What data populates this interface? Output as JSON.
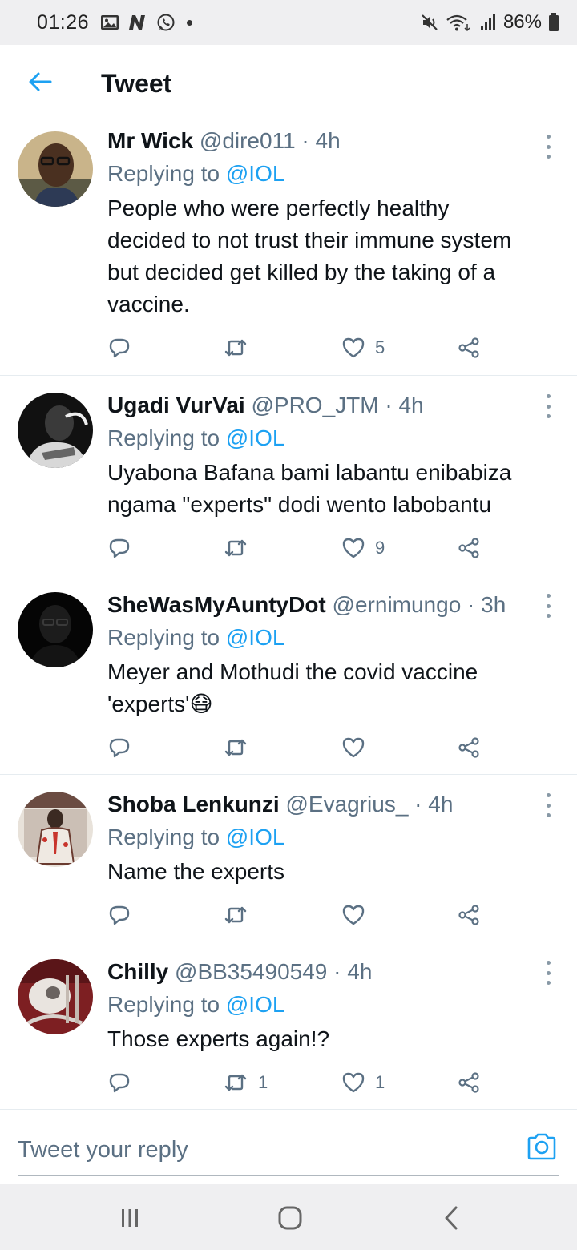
{
  "status_bar": {
    "time": "01:26",
    "battery": "86%",
    "left_icons": [
      "gallery-icon",
      "n-icon",
      "whatsapp-icon",
      "dot"
    ],
    "right_icons": [
      "mute-icon",
      "wifi-icon",
      "signal-icon",
      "battery-icon"
    ]
  },
  "header": {
    "title": "Tweet",
    "back_icon": "arrow-left-icon"
  },
  "colors": {
    "accent": "#1da1f2",
    "muted": "#5b7083",
    "text": "#0f1419",
    "divider": "#e6ecf0"
  },
  "tweets": [
    {
      "name": "Mr Wick",
      "meta": "@dire011 · 4h",
      "replying_prefix": "Replying to ",
      "replying_to": "@IOL",
      "text": "People who were perfectly healthy decided to not trust their immune system but decided get killed by the taking of a vaccine.",
      "replies": "",
      "retweets": "",
      "likes": "5"
    },
    {
      "name": "Ugadi VurVai",
      "meta": "@PRO_JTM · 4h",
      "replying_prefix": "Replying to ",
      "replying_to": "@IOL",
      "text": "Uyabona Bafana bami labantu enibabiza ngama \"experts\" dodi wento labobantu",
      "replies": "",
      "retweets": "",
      "likes": "9"
    },
    {
      "name": "SheWasMyAuntyDot",
      "meta": "@ernimungo · 3h",
      "replying_prefix": "Replying to ",
      "replying_to": "@IOL",
      "text": "Meyer and Mothudi the covid vaccine 'experts'😷",
      "replies": "",
      "retweets": "",
      "likes": ""
    },
    {
      "name": "Shoba Lenkunzi",
      "meta": "@Evagrius_ · 4h",
      "replying_prefix": "Replying to ",
      "replying_to": "@IOL",
      "text": "Name the experts",
      "replies": "",
      "retweets": "",
      "likes": ""
    },
    {
      "name": "Chilly",
      "meta": "@BB35490549 · 4h",
      "replying_prefix": "Replying to ",
      "replying_to": "@IOL",
      "text": "Those experts again!?",
      "replies": "",
      "retweets": "1",
      "likes": "1"
    }
  ],
  "composer": {
    "placeholder": "Tweet your reply",
    "value": ""
  },
  "nav_bar": {
    "buttons": [
      "recent-apps-icon",
      "home-icon",
      "back-icon"
    ]
  }
}
